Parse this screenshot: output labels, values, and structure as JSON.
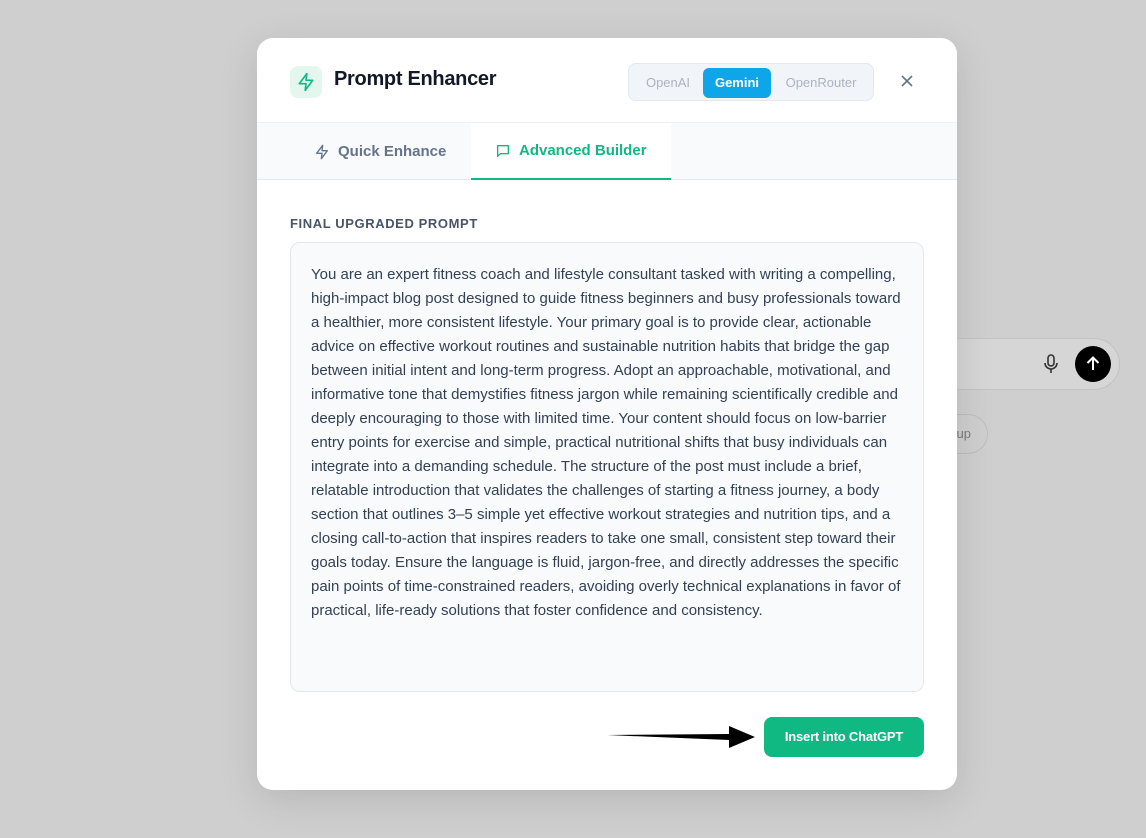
{
  "background": {
    "chip_text": "up"
  },
  "header": {
    "title": "Prompt Enhancer",
    "providers": [
      {
        "label": "OpenAI",
        "selected": false
      },
      {
        "label": "Gemini",
        "selected": true
      },
      {
        "label": "OpenRouter",
        "selected": false
      }
    ]
  },
  "tabs": [
    {
      "label": "Quick Enhance",
      "active": false,
      "icon": "lightning-icon"
    },
    {
      "label": "Advanced Builder",
      "active": true,
      "icon": "message-square-icon"
    }
  ],
  "section": {
    "label": "FINAL UPGRADED PROMPT",
    "prompt_text": "You are an expert fitness coach and lifestyle consultant tasked with writing a compelling, high-impact blog post designed to guide fitness beginners and busy professionals toward a healthier, more consistent lifestyle. Your primary goal is to provide clear, actionable advice on effective workout routines and sustainable nutrition habits that bridge the gap between initial intent and long-term progress. Adopt an approachable, motivational, and informative tone that demystifies fitness jargon while remaining scientifically credible and deeply encouraging to those with limited time. Your content should focus on low-barrier entry points for exercise and simple, practical nutritional shifts that busy individuals can integrate into a demanding schedule. The structure of the post must include a brief, relatable introduction that validates the challenges of starting a fitness journey, a body section that outlines 3–5 simple yet effective workout strategies and nutrition tips, and a closing call-to-action that inspires readers to take one small, consistent step toward their goals today. Ensure the language is fluid, jargon-free, and directly addresses the specific pain points of time-constrained readers, avoiding overly technical explanations in favor of practical, life-ready solutions that foster confidence and consistency."
  },
  "actions": {
    "insert_label": "Insert into ChatGPT"
  },
  "colors": {
    "accent": "#10b981",
    "selected_provider": "#0ea5e9"
  }
}
